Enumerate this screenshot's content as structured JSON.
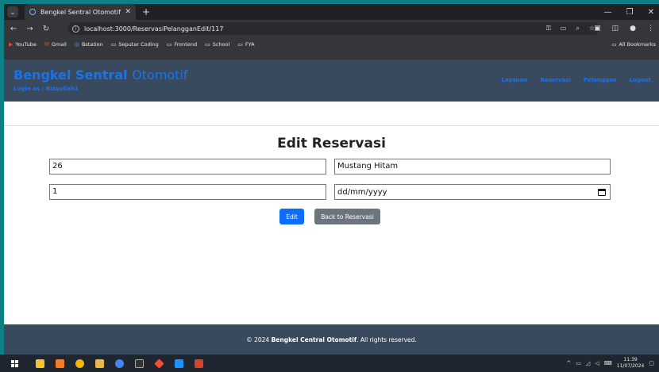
{
  "browser": {
    "tab_title": "Bengkel Sentral Otomotif",
    "url": "localhost:3000/ReservasiPelangganEdit/117",
    "bookmarks": [
      "YouTube",
      "Gmail",
      "Bstation",
      "Seputar Coding",
      "Frontend",
      "School",
      "FYA"
    ],
    "all_bookmarks": "All Bookmarks"
  },
  "navbar": {
    "brand_bold": "Bengkel Sentral",
    "brand_light": "Otomotif",
    "login_as": "Login as : Rizqullah1",
    "links": [
      "Layanan",
      "Reservasi",
      "Pelanggan",
      "Logout"
    ]
  },
  "form": {
    "title": "Edit Reservasi",
    "field_1": "26",
    "field_2": "Mustang Hitam",
    "field_3": "1",
    "date_placeholder": "dd/mm/yyyy",
    "edit_label": "Edit",
    "back_label": "Back to Reservasi"
  },
  "footer": {
    "prefix": "© 2024",
    "name": "Bengkel Central Otomotif",
    "suffix": ". All rights reserved."
  },
  "taskbar": {
    "time": "11:39",
    "date": "11/07/2024"
  },
  "colors": {
    "accent": "#1a73e8",
    "navbar": "#3a4a5e",
    "edit_button": "#0d6efd",
    "back_button": "#6c757d"
  }
}
